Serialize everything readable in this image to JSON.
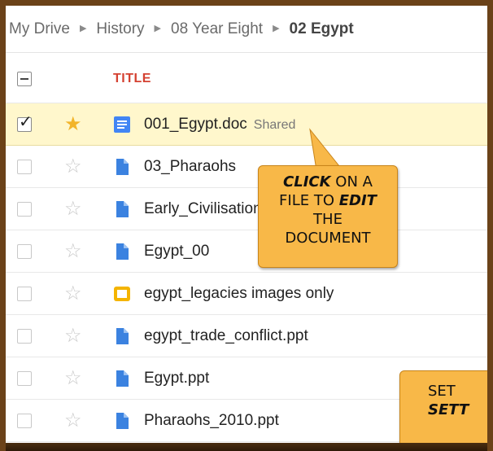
{
  "breadcrumb": [
    "My Drive",
    "History",
    "08 Year Eight",
    "02 Egypt"
  ],
  "header": {
    "title": "TITLE"
  },
  "files": [
    {
      "name": "001_Egypt.doc",
      "tag": "Shared",
      "icon": "document-icon",
      "selected": true,
      "starred": true,
      "checked": true
    },
    {
      "name": "03_Pharaohs",
      "tag": "",
      "icon": "file-icon",
      "selected": false,
      "starred": false,
      "checked": false
    },
    {
      "name": "Early_Civilisations",
      "tag": "",
      "icon": "file-icon",
      "selected": false,
      "starred": false,
      "checked": false
    },
    {
      "name": "Egypt_00",
      "tag": "",
      "icon": "file-icon",
      "selected": false,
      "starred": false,
      "checked": false
    },
    {
      "name": "egypt_legacies images only",
      "tag": "",
      "icon": "presentation-icon",
      "selected": false,
      "starred": false,
      "checked": false
    },
    {
      "name": "egypt_trade_conflict.ppt",
      "tag": "",
      "icon": "file-icon",
      "selected": false,
      "starred": false,
      "checked": false
    },
    {
      "name": "Egypt.ppt",
      "tag": "",
      "icon": "file-icon",
      "selected": false,
      "starred": false,
      "checked": false
    },
    {
      "name": "Pharaohs_2010.ppt",
      "tag": "",
      "icon": "file-icon",
      "selected": false,
      "starred": false,
      "checked": false
    }
  ],
  "callouts": {
    "edit": {
      "w1": "Click",
      "w2": "on a",
      "w3": "file to",
      "w4": "edit",
      "w5": "the",
      "w6": "document"
    },
    "settings": {
      "line1": "Set",
      "line2": "Sett"
    }
  },
  "colors": {
    "accent": "#d44131",
    "callout": "#f8b848",
    "selected_row": "#fff7cc",
    "star": "#f2b42a",
    "doc_blue": "#4285f4",
    "slides_yellow": "#f4b400"
  }
}
